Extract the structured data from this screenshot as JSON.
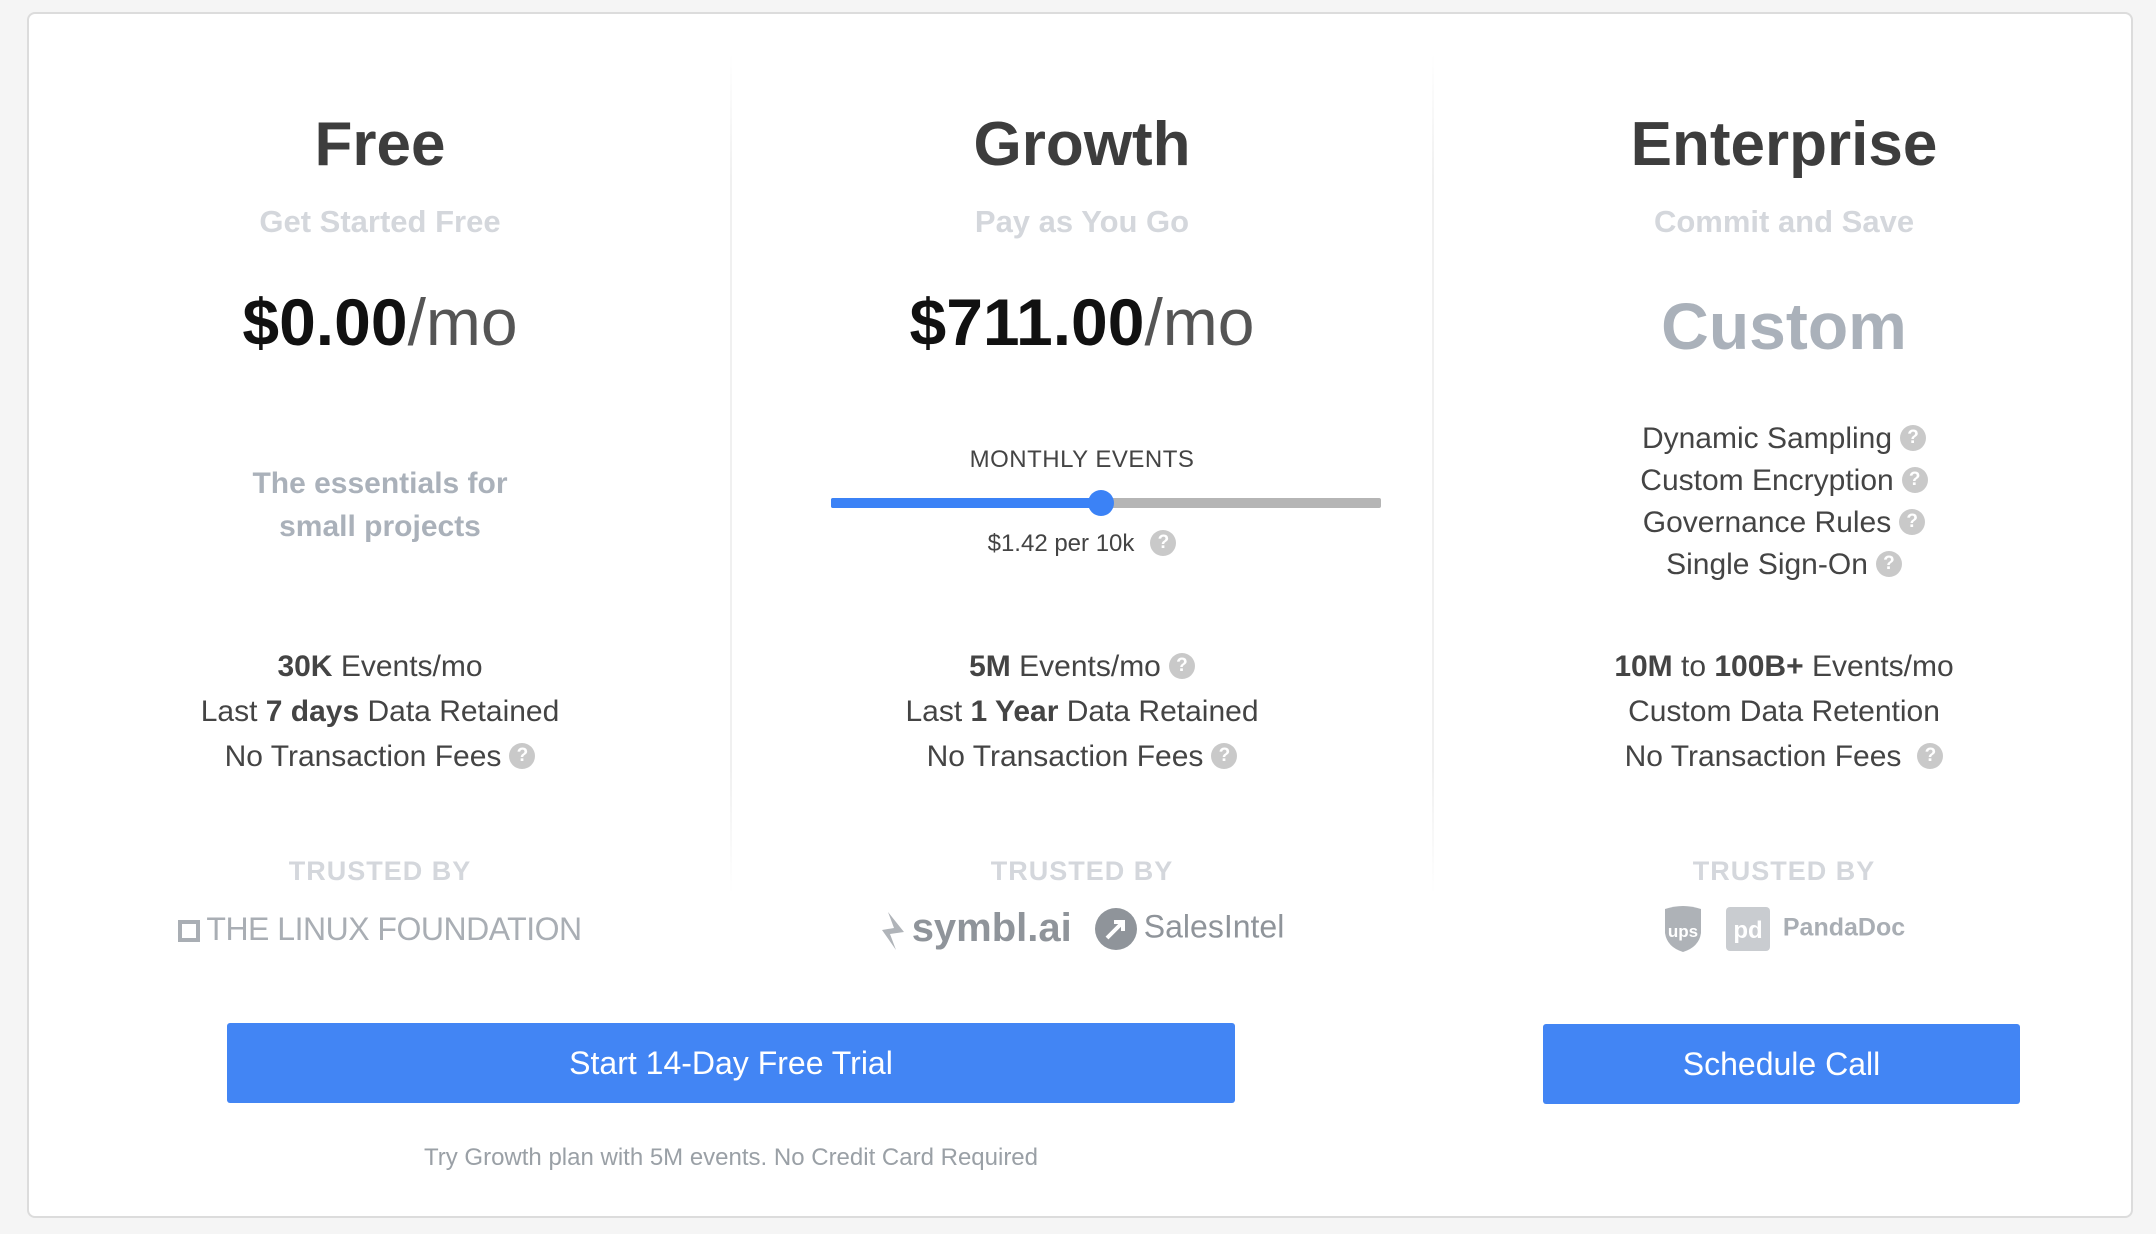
{
  "plans": [
    {
      "title": "Free",
      "subtitle": "Get Started Free",
      "price_amount": "$0.00",
      "price_unit": "/mo",
      "tagline_line1": "The essentials for",
      "tagline_line2": "small projects",
      "features": [
        {
          "bold": "30K",
          "text": " Events/mo"
        },
        {
          "pre": "Last ",
          "bold": "7 days",
          "text": " Data Retained"
        },
        {
          "text": "No Transaction Fees"
        }
      ],
      "trusted_label": "TRUSTED BY",
      "logos": [
        "THE LINUX FOUNDATION"
      ]
    },
    {
      "title": "Growth",
      "subtitle": "Pay as You Go",
      "price_amount": "$711.00",
      "price_unit": "/mo",
      "slider_label": "MONTHLY EVENTS",
      "slider_fraction": 0.49,
      "rate": "$1.42 per 10k",
      "features": [
        {
          "bold": "5M",
          "text": " Events/mo"
        },
        {
          "pre": "Last ",
          "bold": "1 Year",
          "text": " Data Retained"
        },
        {
          "text": "No Transaction Fees"
        }
      ],
      "trusted_label": "TRUSTED BY",
      "logos": [
        "symbl.ai",
        "SalesIntel"
      ]
    },
    {
      "title": "Enterprise",
      "subtitle": "Commit and Save",
      "price_custom": "Custom",
      "perks": [
        "Dynamic Sampling",
        "Custom Encryption",
        "Governance Rules",
        "Single Sign-On"
      ],
      "features": [
        {
          "bold": "10M",
          "mid": " to ",
          "bold2": "100B+",
          "text": " Events/mo"
        },
        {
          "text": "Custom Data Retention"
        },
        {
          "text": "No Transaction Fees"
        }
      ],
      "trusted_label": "TRUSTED BY",
      "logos": [
        "ups",
        "PandaDoc"
      ]
    }
  ],
  "buttons": {
    "trial": "Start 14-Day Free Trial",
    "schedule": "Schedule Call"
  },
  "trial_note": "Try Growth plan with 5M events. No Credit Card Required",
  "icons": {
    "help": "question-circle-icon",
    "help_glyph": "?"
  },
  "colors": {
    "accent": "#4285f4",
    "slider": "#3b82f6"
  }
}
